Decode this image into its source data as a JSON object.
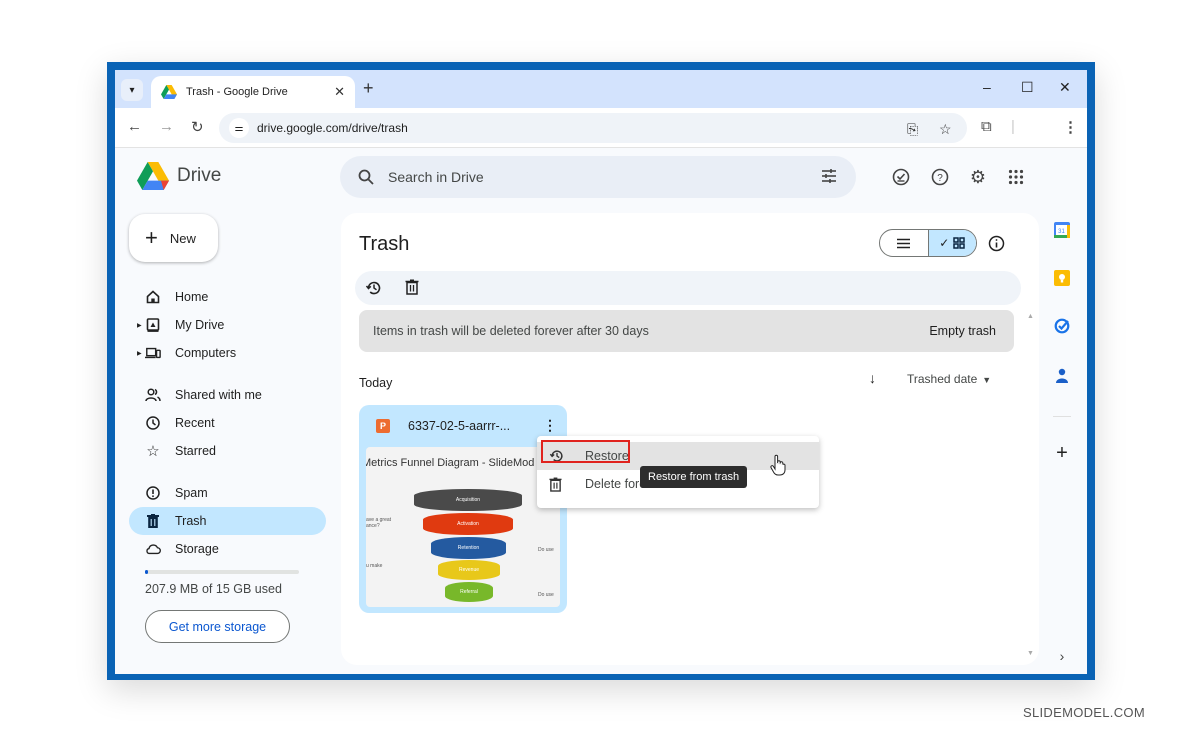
{
  "browser": {
    "tab_title": "Trash - Google Drive",
    "new_tab": "+",
    "url": "drive.google.com/drive/trash",
    "window_controls": [
      "minimize",
      "maximize",
      "close"
    ]
  },
  "drive": {
    "app_name": "Drive",
    "search_placeholder": "Search in Drive",
    "new_label": "New",
    "sidebar": {
      "items": [
        {
          "label": "Home",
          "icon": "home-icon"
        },
        {
          "label": "My Drive",
          "icon": "my-drive-icon"
        },
        {
          "label": "Computers",
          "icon": "computers-icon"
        },
        {
          "label": "Shared with me",
          "icon": "shared-icon"
        },
        {
          "label": "Recent",
          "icon": "clock-icon"
        },
        {
          "label": "Starred",
          "icon": "star-icon"
        },
        {
          "label": "Spam",
          "icon": "spam-icon"
        },
        {
          "label": "Trash",
          "icon": "trash-icon",
          "active": true
        },
        {
          "label": "Storage",
          "icon": "cloud-icon"
        }
      ],
      "storage_used_text": "207.9 MB of 15 GB used",
      "storage_fraction": 0.014,
      "get_more_storage": "Get more storage"
    },
    "main": {
      "title": "Trash",
      "banner_text": "Items in trash will be deleted forever after 30 days",
      "empty_trash": "Empty trash",
      "section": "Today",
      "sort_label": "Trashed date",
      "file": {
        "name": "6337-02-5-aarrr-...",
        "type_badge": "P",
        "thumbnail_title": "Metrics Funnel Diagram - SlideMod",
        "funnel_stages": [
          "Acquisition",
          "Activation",
          "Retention",
          "Revenue",
          "Referral"
        ],
        "side_labels": [
          "ave a great ance?",
          "u make",
          "Do use",
          "Do use"
        ]
      }
    },
    "context_menu": {
      "items": [
        "Restore",
        "Delete forever"
      ],
      "visible_delete_text": "Delete fore",
      "tooltip": "Restore from trash"
    }
  },
  "colors": {
    "frame": "#0a63b5",
    "active_nav": "#c2e7ff",
    "highlight": "#e0231e",
    "accent": "#0b57d0"
  },
  "watermark": "SLIDEMODEL.COM"
}
